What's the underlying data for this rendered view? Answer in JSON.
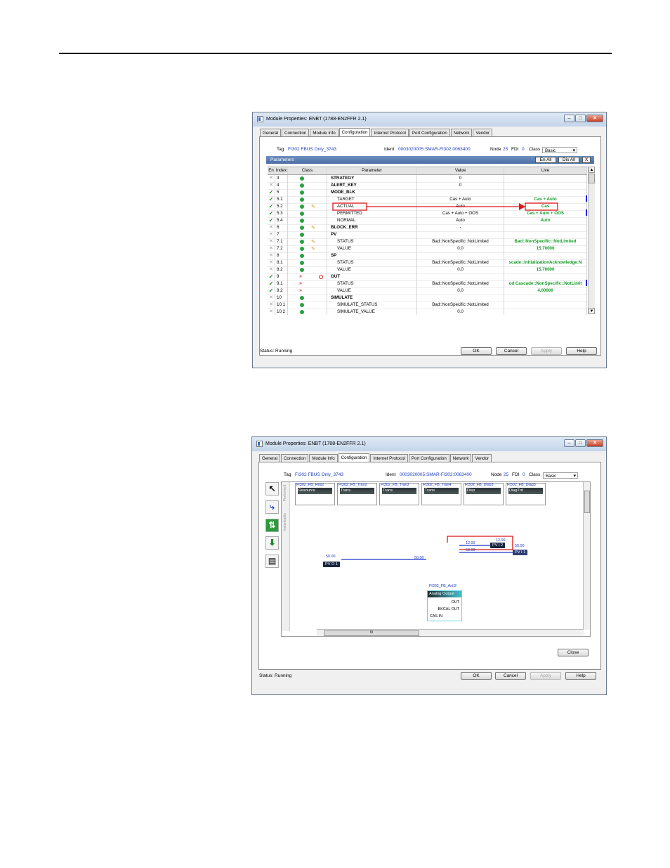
{
  "window1": {
    "title": "Module Properties: ENBT (1788-EN2FFR 2.1)",
    "tabs": [
      "General",
      "Connection",
      "Module Info",
      "Configuration",
      "Internet Protocol",
      "Port Configuration",
      "Network",
      "Vendor"
    ],
    "tag_label": "Tag",
    "tag_value": "FI302 FBUS Only_3743",
    "ident_label": "Ident",
    "ident_value": "0003020005:SMAR-FI302:0063400",
    "node_label": "Node",
    "node_value": "25",
    "fdi_label": "FDI",
    "fdi_value": "0",
    "class_label": "Class",
    "class_value": "Basic",
    "parameters_label": "Parameters",
    "en_all": "En All",
    "dis_all": "Dis All",
    "close_x": "X",
    "columns": [
      "En",
      "Index",
      "Class",
      "Parameter",
      "Value",
      "Live"
    ],
    "rows": [
      {
        "en": "x",
        "index": "3",
        "parameter": "STRATEGY",
        "value": "0",
        "live": "",
        "kind": "hdr",
        "cls": "g"
      },
      {
        "en": "x",
        "index": "4",
        "parameter": "ALERT_KEY",
        "value": "0",
        "live": "",
        "kind": "hdr",
        "cls": "g"
      },
      {
        "en": "v",
        "index": "5",
        "parameter": "MODE_BLK",
        "value": "",
        "live": "",
        "kind": "hdr",
        "cls": "g"
      },
      {
        "en": "v",
        "index": "5.1",
        "parameter": "TARGET",
        "value": "Cas + Auto",
        "live": "Cas + Auto",
        "kind": "sub",
        "cls": "g"
      },
      {
        "en": "v",
        "index": "5.2",
        "parameter": "ACTUAL",
        "value": "Auto",
        "live": "Cas",
        "kind": "sub",
        "cls": "gp"
      },
      {
        "en": "v",
        "index": "5.3",
        "parameter": "PERMITTED",
        "value": "Cas + Auto + OOS",
        "live": "Cas + Auto + OOS",
        "kind": "sub",
        "cls": "g"
      },
      {
        "en": "v",
        "index": "5.4",
        "parameter": "NORMAL",
        "value": "Auto",
        "live": "Auto",
        "kind": "sub",
        "cls": "g"
      },
      {
        "en": "x",
        "index": "6",
        "parameter": "BLOCK_ERR",
        "value": "-",
        "live": "",
        "kind": "hdr",
        "cls": "gp"
      },
      {
        "en": "x",
        "index": "7",
        "parameter": "PV",
        "value": "",
        "live": "",
        "kind": "hdr",
        "cls": "g"
      },
      {
        "en": "x",
        "index": "7.1",
        "parameter": "STATUS",
        "value": "Bad::NonSpecific::NotLimited",
        "live": "Bad::NonSpecific::NotLimited",
        "kind": "sub",
        "cls": "gp"
      },
      {
        "en": "x",
        "index": "7.2",
        "parameter": "VALUE",
        "value": "0.0",
        "live": "15.70000",
        "kind": "sub",
        "cls": "gp"
      },
      {
        "en": "x",
        "index": "8",
        "parameter": "SP",
        "value": "",
        "live": "",
        "kind": "hdr",
        "cls": "g"
      },
      {
        "en": "x",
        "index": "8.1",
        "parameter": "STATUS",
        "value": "Bad::NonSpecific::NotLimited",
        "live": "scade::InitializationAcknowledge:N",
        "kind": "sub",
        "cls": "g"
      },
      {
        "en": "x",
        "index": "8.2",
        "parameter": "VALUE",
        "value": "0.0",
        "live": "15.70000",
        "kind": "sub",
        "cls": "g"
      },
      {
        "en": "v",
        "index": "9",
        "parameter": "OUT",
        "value": "",
        "live": "",
        "kind": "hdr",
        "cls": "ar"
      },
      {
        "en": "v",
        "index": "9.1",
        "parameter": "STATUS",
        "value": "Bad::NonSpecific::NotLimited",
        "live": "od Cascade::NonSpecific::NotLimit",
        "kind": "sub",
        "cls": "a"
      },
      {
        "en": "v",
        "index": "9.2",
        "parameter": "VALUE",
        "value": "0.0",
        "live": "4.00000",
        "kind": "sub",
        "cls": "a"
      },
      {
        "en": "x",
        "index": "10",
        "parameter": "SIMULATE",
        "value": "",
        "live": "",
        "kind": "hdr",
        "cls": "g"
      },
      {
        "en": "x",
        "index": "10.1",
        "parameter": "SIMULATE_STATUS",
        "value": "Bad::NonSpecific::NotLimited",
        "live": "",
        "kind": "sub",
        "cls": "g"
      },
      {
        "en": "x",
        "index": "10.2",
        "parameter": "SIMULATE_VALUE",
        "value": "0.0",
        "live": "",
        "kind": "sub",
        "cls": "g"
      }
    ],
    "status": "Status:  Running",
    "buttons": {
      "ok": "OK",
      "cancel": "Cancel",
      "apply": "Apply",
      "help": "Help"
    }
  },
  "window2": {
    "title": "Module Properties: ENBT (1788-EN2FFR 2.1)",
    "tabs": [
      "General",
      "Connection",
      "Module Info",
      "Configuration",
      "Internet Protocol",
      "Port Configuration",
      "Network",
      "Vendor"
    ],
    "tag_label": "Tag",
    "tag_value": "FI302 FBUS Only_3743",
    "ident_label": "Ident",
    "ident_value": "0003020005:SMAR-FI302:0063400",
    "node_label": "Node",
    "node_value": "25",
    "fdi_label": "FDI",
    "fdi_value": "0",
    "class_label": "Class",
    "class_value": "Basic",
    "strip_top": "Performed",
    "strip_mid": "Instantiable",
    "blocks": [
      {
        "title": "FI302_FB_Res2",
        "name": "Resource"
      },
      {
        "title": "FI302_FB_Tran2",
        "name": "Trans"
      },
      {
        "title": "FI302_FB_Tran3",
        "name": "Trans"
      },
      {
        "title": "FI302_FB_Tran4",
        "name": "Trans"
      },
      {
        "title": "FI302_FB_Disp3",
        "name": "Disp"
      },
      {
        "title": "FI302_FB_Diag3",
        "name": "DiagTrd"
      }
    ],
    "ai_block": {
      "title": "FI302_FB_AnlI2",
      "name": "Analog Output",
      "pin_out": "OUT",
      "pin_bkcal": "BKCAL OUT",
      "pin_cas": "CAS IN"
    },
    "values": {
      "pvo1": "50.00",
      "cas_in": "50.00",
      "out_line": "12.00",
      "pvi2": "12.00",
      "pvi1_a": "50.00",
      "pvi1_b": "50.00"
    },
    "tags": {
      "pvo1": "PV O 1",
      "pvi2": "PV I 2",
      "pvi1": "PV I 1"
    },
    "hscroll_label": "III",
    "close_button": "Close",
    "status": "Status:  Running",
    "buttons": {
      "ok": "OK",
      "cancel": "Cancel",
      "apply": "Apply",
      "help": "Help"
    }
  }
}
